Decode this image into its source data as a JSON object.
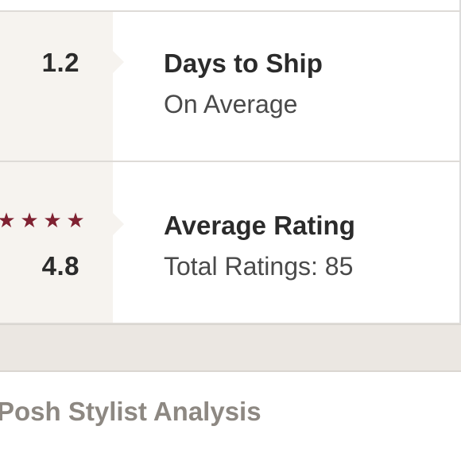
{
  "stats": {
    "shipping": {
      "value": "1.2",
      "title": "Days to Ship",
      "subtitle": "On Average"
    },
    "rating": {
      "value": "4.8",
      "stars_shown": 4,
      "star_color": "#7f2131",
      "title": "Average Rating",
      "subtitle": "Total Ratings: 85"
    }
  },
  "section": {
    "title": "Posh Stylist Analysis"
  },
  "colors": {
    "metric_bg": "#f6f3ef",
    "band_bg": "#ebe7e2",
    "section_title": "#8d8882"
  }
}
